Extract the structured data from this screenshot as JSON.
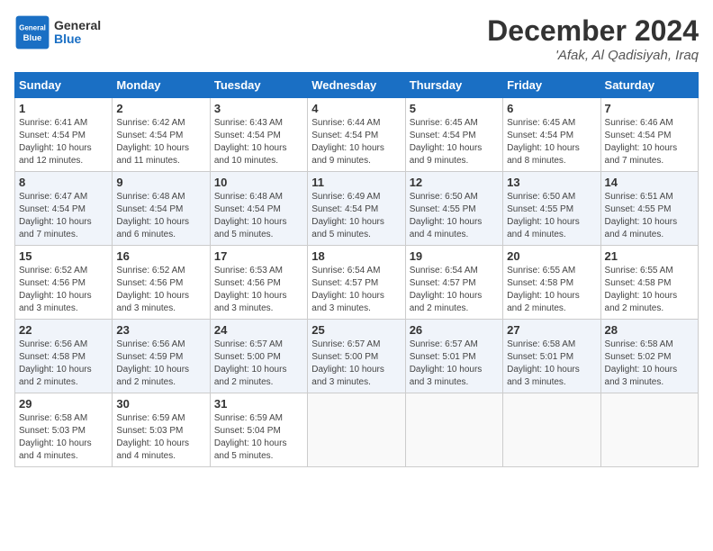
{
  "header": {
    "logo_general": "General",
    "logo_blue": "Blue",
    "main_title": "December 2024",
    "subtitle": "'Afak, Al Qadisiyah, Iraq"
  },
  "calendar": {
    "days_of_week": [
      "Sunday",
      "Monday",
      "Tuesday",
      "Wednesday",
      "Thursday",
      "Friday",
      "Saturday"
    ],
    "weeks": [
      [
        {
          "day": "1",
          "sunrise": "6:41 AM",
          "sunset": "4:54 PM",
          "daylight": "10 hours and 12 minutes."
        },
        {
          "day": "2",
          "sunrise": "6:42 AM",
          "sunset": "4:54 PM",
          "daylight": "10 hours and 11 minutes."
        },
        {
          "day": "3",
          "sunrise": "6:43 AM",
          "sunset": "4:54 PM",
          "daylight": "10 hours and 10 minutes."
        },
        {
          "day": "4",
          "sunrise": "6:44 AM",
          "sunset": "4:54 PM",
          "daylight": "10 hours and 9 minutes."
        },
        {
          "day": "5",
          "sunrise": "6:45 AM",
          "sunset": "4:54 PM",
          "daylight": "10 hours and 9 minutes."
        },
        {
          "day": "6",
          "sunrise": "6:45 AM",
          "sunset": "4:54 PM",
          "daylight": "10 hours and 8 minutes."
        },
        {
          "day": "7",
          "sunrise": "6:46 AM",
          "sunset": "4:54 PM",
          "daylight": "10 hours and 7 minutes."
        }
      ],
      [
        {
          "day": "8",
          "sunrise": "6:47 AM",
          "sunset": "4:54 PM",
          "daylight": "10 hours and 7 minutes."
        },
        {
          "day": "9",
          "sunrise": "6:48 AM",
          "sunset": "4:54 PM",
          "daylight": "10 hours and 6 minutes."
        },
        {
          "day": "10",
          "sunrise": "6:48 AM",
          "sunset": "4:54 PM",
          "daylight": "10 hours and 5 minutes."
        },
        {
          "day": "11",
          "sunrise": "6:49 AM",
          "sunset": "4:54 PM",
          "daylight": "10 hours and 5 minutes."
        },
        {
          "day": "12",
          "sunrise": "6:50 AM",
          "sunset": "4:55 PM",
          "daylight": "10 hours and 4 minutes."
        },
        {
          "day": "13",
          "sunrise": "6:50 AM",
          "sunset": "4:55 PM",
          "daylight": "10 hours and 4 minutes."
        },
        {
          "day": "14",
          "sunrise": "6:51 AM",
          "sunset": "4:55 PM",
          "daylight": "10 hours and 4 minutes."
        }
      ],
      [
        {
          "day": "15",
          "sunrise": "6:52 AM",
          "sunset": "4:56 PM",
          "daylight": "10 hours and 3 minutes."
        },
        {
          "day": "16",
          "sunrise": "6:52 AM",
          "sunset": "4:56 PM",
          "daylight": "10 hours and 3 minutes."
        },
        {
          "day": "17",
          "sunrise": "6:53 AM",
          "sunset": "4:56 PM",
          "daylight": "10 hours and 3 minutes."
        },
        {
          "day": "18",
          "sunrise": "6:54 AM",
          "sunset": "4:57 PM",
          "daylight": "10 hours and 3 minutes."
        },
        {
          "day": "19",
          "sunrise": "6:54 AM",
          "sunset": "4:57 PM",
          "daylight": "10 hours and 2 minutes."
        },
        {
          "day": "20",
          "sunrise": "6:55 AM",
          "sunset": "4:58 PM",
          "daylight": "10 hours and 2 minutes."
        },
        {
          "day": "21",
          "sunrise": "6:55 AM",
          "sunset": "4:58 PM",
          "daylight": "10 hours and 2 minutes."
        }
      ],
      [
        {
          "day": "22",
          "sunrise": "6:56 AM",
          "sunset": "4:58 PM",
          "daylight": "10 hours and 2 minutes."
        },
        {
          "day": "23",
          "sunrise": "6:56 AM",
          "sunset": "4:59 PM",
          "daylight": "10 hours and 2 minutes."
        },
        {
          "day": "24",
          "sunrise": "6:57 AM",
          "sunset": "5:00 PM",
          "daylight": "10 hours and 2 minutes."
        },
        {
          "day": "25",
          "sunrise": "6:57 AM",
          "sunset": "5:00 PM",
          "daylight": "10 hours and 3 minutes."
        },
        {
          "day": "26",
          "sunrise": "6:57 AM",
          "sunset": "5:01 PM",
          "daylight": "10 hours and 3 minutes."
        },
        {
          "day": "27",
          "sunrise": "6:58 AM",
          "sunset": "5:01 PM",
          "daylight": "10 hours and 3 minutes."
        },
        {
          "day": "28",
          "sunrise": "6:58 AM",
          "sunset": "5:02 PM",
          "daylight": "10 hours and 3 minutes."
        }
      ],
      [
        {
          "day": "29",
          "sunrise": "6:58 AM",
          "sunset": "5:03 PM",
          "daylight": "10 hours and 4 minutes."
        },
        {
          "day": "30",
          "sunrise": "6:59 AM",
          "sunset": "5:03 PM",
          "daylight": "10 hours and 4 minutes."
        },
        {
          "day": "31",
          "sunrise": "6:59 AM",
          "sunset": "5:04 PM",
          "daylight": "10 hours and 5 minutes."
        },
        null,
        null,
        null,
        null
      ]
    ]
  }
}
